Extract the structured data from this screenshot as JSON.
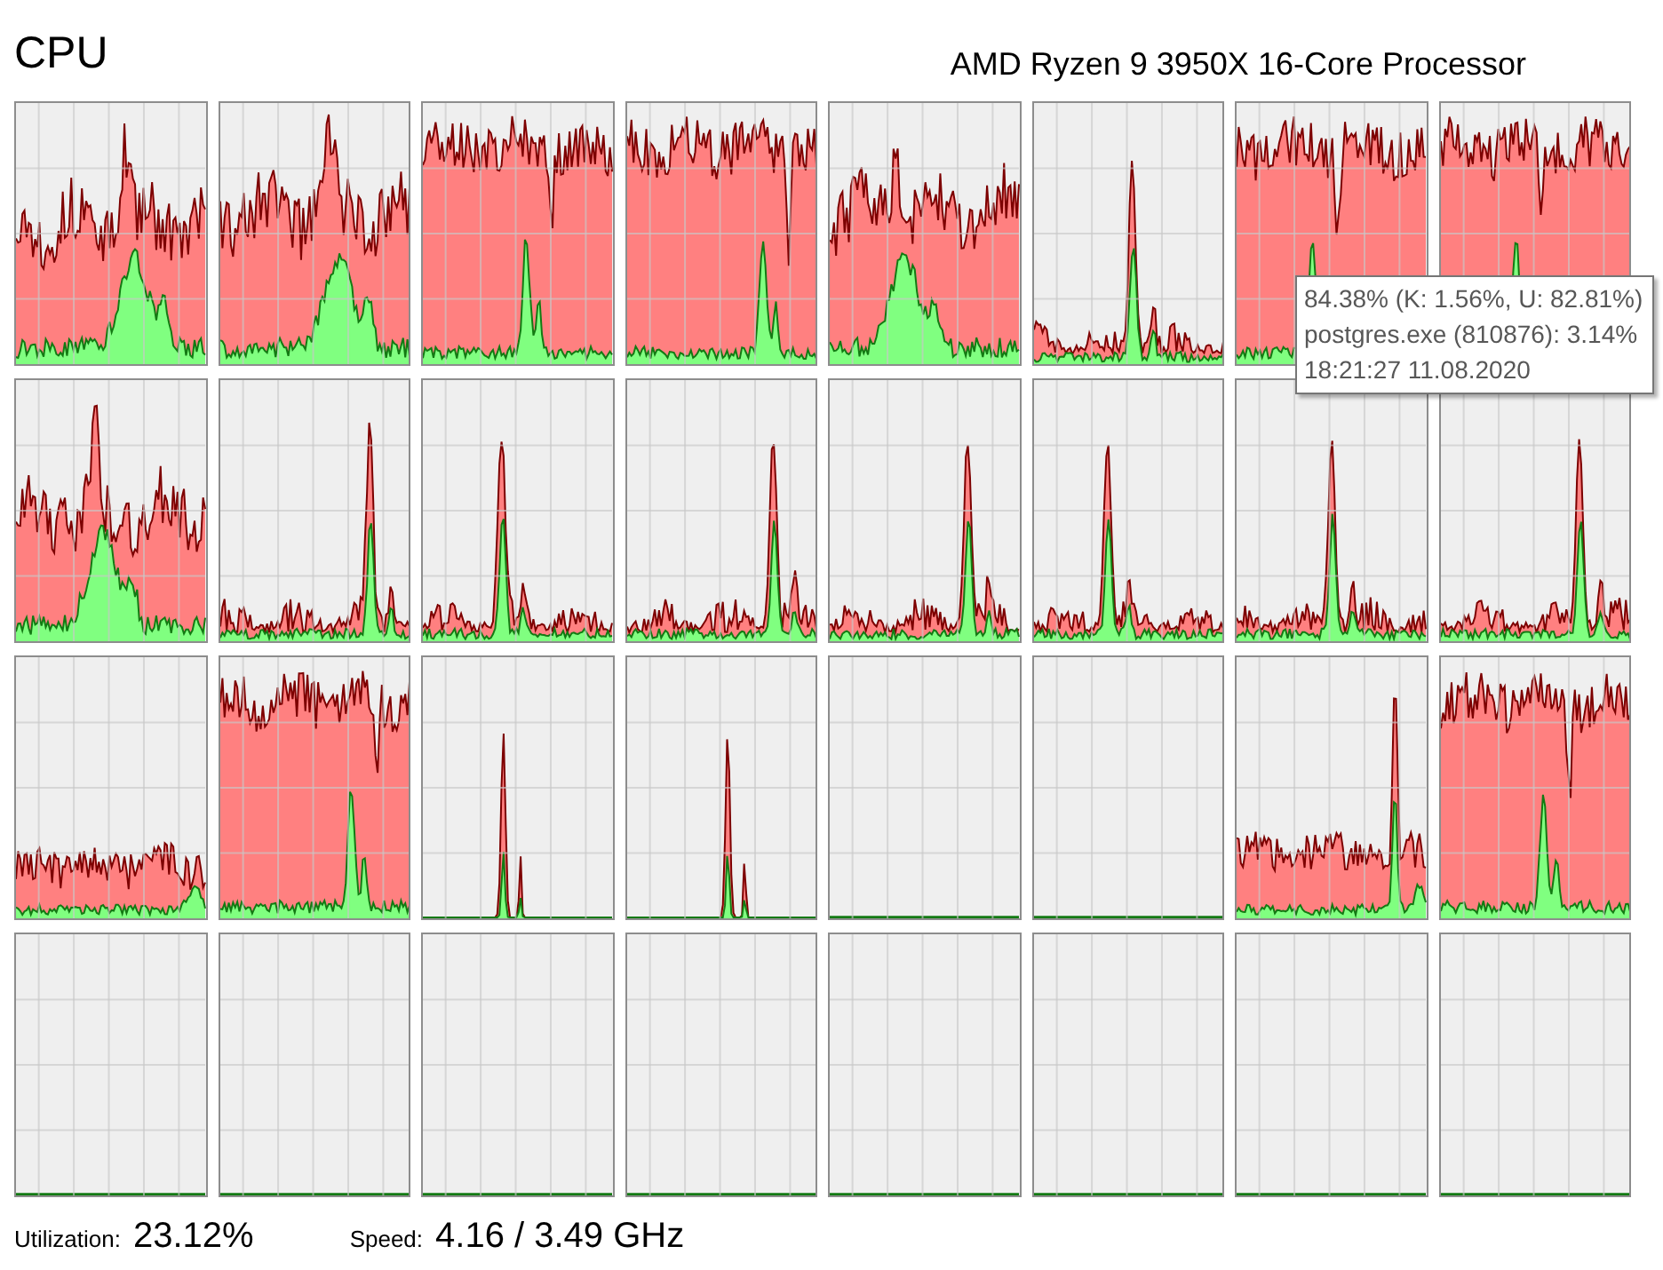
{
  "header": {
    "title": "CPU",
    "processor": "AMD Ryzen 9 3950X 16-Core Processor"
  },
  "graphs": [
    {
      "kind": "mixed"
    },
    {
      "kind": "mixed"
    },
    {
      "kind": "busy"
    },
    {
      "kind": "busy"
    },
    {
      "kind": "mixed"
    },
    {
      "kind": "spike"
    },
    {
      "kind": "busy"
    },
    {
      "kind": "busy"
    },
    {
      "kind": "mixed"
    },
    {
      "kind": "spike"
    },
    {
      "kind": "spike"
    },
    {
      "kind": "spike"
    },
    {
      "kind": "spike"
    },
    {
      "kind": "spike"
    },
    {
      "kind": "spike"
    },
    {
      "kind": "spike"
    },
    {
      "kind": "low"
    },
    {
      "kind": "busy"
    },
    {
      "kind": "blip"
    },
    {
      "kind": "blip"
    },
    {
      "kind": "idle"
    },
    {
      "kind": "idle"
    },
    {
      "kind": "surge"
    },
    {
      "kind": "busy"
    },
    {
      "kind": "idle"
    },
    {
      "kind": "idle"
    },
    {
      "kind": "idle"
    },
    {
      "kind": "idle"
    },
    {
      "kind": "idle"
    },
    {
      "kind": "idle"
    },
    {
      "kind": "idle"
    },
    {
      "kind": "idle"
    }
  ],
  "tooltip": {
    "lines": [
      "84.38% (K: 1.56%, U: 82.81%)",
      "postgres.exe (810876): 3.14%",
      "18:21:27 11.08.2020"
    ]
  },
  "stats": [
    {
      "label": "Utilization:",
      "value": "23.12%"
    },
    {
      "label": "Speed:",
      "value": "4.16 / 3.49 GHz"
    }
  ]
}
